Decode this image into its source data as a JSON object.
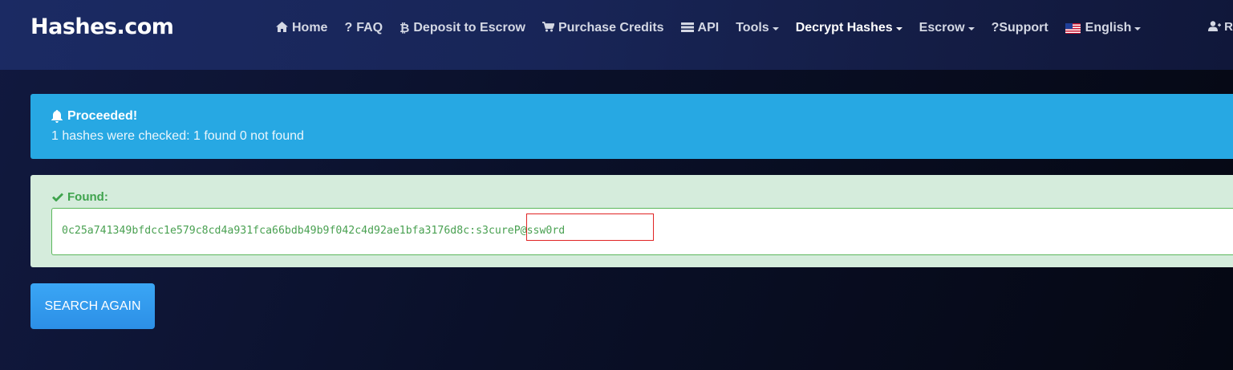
{
  "brand": {
    "name": "Hashes.com"
  },
  "nav": {
    "items": [
      {
        "label": "Home",
        "icon": "home-icon"
      },
      {
        "label": "FAQ",
        "icon": "question-icon"
      },
      {
        "label": "Deposit to Escrow",
        "icon": "bitcoin-icon"
      },
      {
        "label": "Purchase Credits",
        "icon": "cart-icon"
      },
      {
        "label": "API",
        "icon": "server-icon"
      },
      {
        "label": "Tools",
        "dropdown": true
      },
      {
        "label": "Decrypt Hashes",
        "dropdown": true,
        "active": true
      },
      {
        "label": "Escrow",
        "dropdown": true
      },
      {
        "label": "?Support"
      },
      {
        "label": "English",
        "icon": "us-flag-icon",
        "dropdown": true
      }
    ],
    "user_partial": "R"
  },
  "alert_info": {
    "title": "Proceeded!",
    "message": "1 hashes were checked: 1 found 0 not found",
    "color": "#27a8e3"
  },
  "alert_success": {
    "title": "Found:",
    "hash": "0c25a741349bfdcc1e579c8cd4a931fca66bdb49b9f042c4d92ae1bfa3176d8c",
    "separator": ":",
    "plaintext": "s3cureP@ssw0rd",
    "color": "#d5ecdc",
    "text_color": "#4aa152"
  },
  "search_again": {
    "label": "SEARCH AGAIN"
  },
  "colors": {
    "highlight_border": "#e02424",
    "button": "#2c8fe6"
  }
}
